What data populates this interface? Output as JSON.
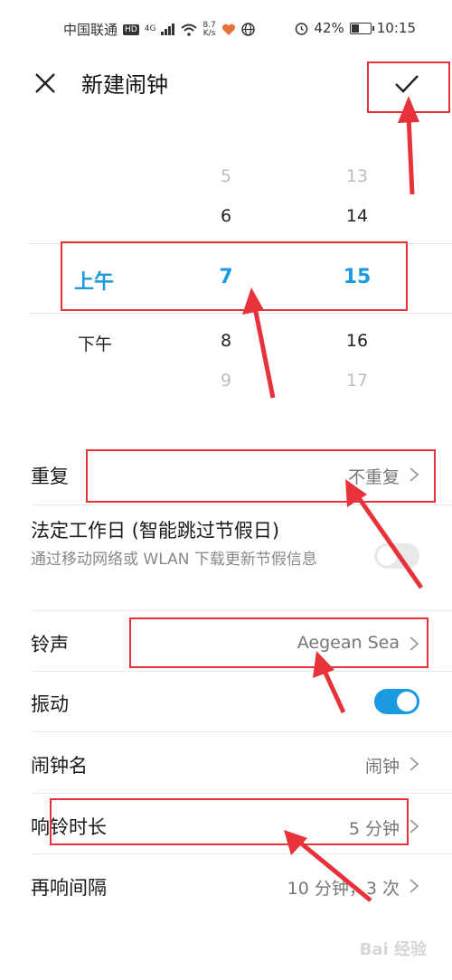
{
  "status_bar": {
    "carrier": "中国联通",
    "hd_badge": "HD",
    "network": "4G",
    "speed_value": "8.7",
    "speed_unit": "K/s",
    "battery": "42%",
    "battery_level": 0.42,
    "time": "10:15"
  },
  "header": {
    "title": "新建闹钟"
  },
  "picker": {
    "ampm": [
      "上午",
      "下午"
    ],
    "hours": [
      "5",
      "6",
      "7",
      "8",
      "9"
    ],
    "minutes": [
      "13",
      "14",
      "15",
      "16",
      "17"
    ],
    "selected": {
      "ampm": "上午",
      "hour": "7",
      "minute": "15"
    }
  },
  "settings": {
    "repeat": {
      "label": "重复",
      "value": "不重复"
    },
    "workday": {
      "label": "法定工作日 (智能跳过节假日)",
      "subtitle": "通过移动网络或 WLAN 下载更新节假信息",
      "enabled": false
    },
    "ringtone": {
      "label": "铃声",
      "value": "Aegean Sea"
    },
    "vibrate": {
      "label": "振动",
      "enabled": true
    },
    "alarm_name": {
      "label": "闹钟名",
      "value": "闹钟"
    },
    "ring_duration": {
      "label": "响铃时长",
      "value": "5 分钟"
    },
    "snooze": {
      "label": "再响间隔",
      "value": "10 分钟，3 次"
    }
  },
  "watermark": "Bai 经验",
  "colors": {
    "accent": "#1b9ae0",
    "annotation": "#e8323a",
    "toggle_off": "#e9e9e9"
  }
}
